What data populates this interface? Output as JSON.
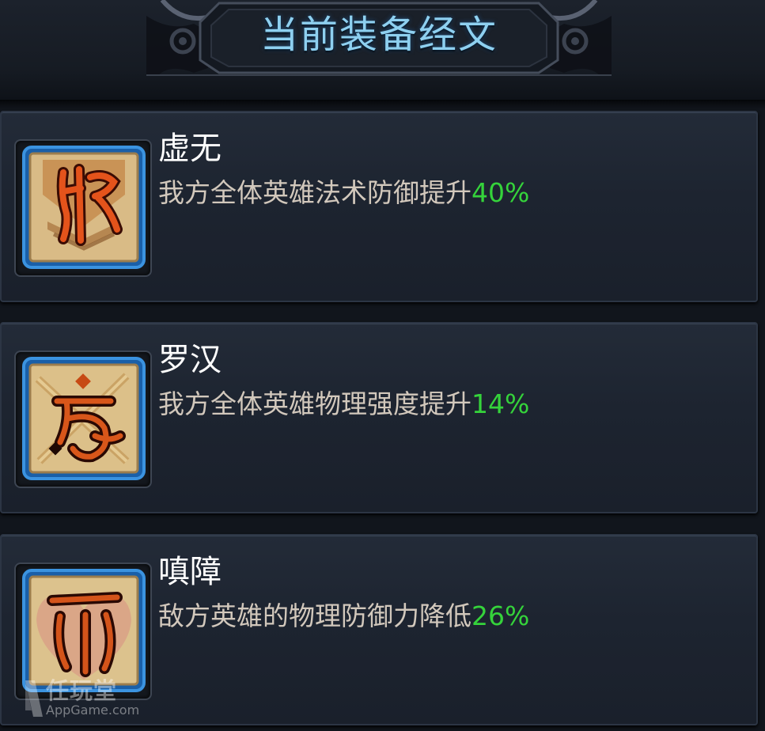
{
  "header": {
    "title": "当前装备经文"
  },
  "scriptures": [
    {
      "name": "虚无",
      "description": "我方全体英雄法术防御提升",
      "value": "40%",
      "icon": "scripture-rune-xuwu-icon"
    },
    {
      "name": "罗汉",
      "description": "我方全体英雄物理强度提升",
      "value": "14%",
      "icon": "scripture-rune-luohan-icon"
    },
    {
      "name": "嗔障",
      "description": "敌方英雄的物理防御力降低",
      "value": "26%",
      "icon": "scripture-rune-chenzhang-icon"
    }
  ],
  "watermark": {
    "brand": "任玩堂",
    "url": "AppGame.com"
  },
  "colors": {
    "title": "#8ed0f0",
    "value": "#35d33b",
    "description": "#d2c8bc",
    "icon_border": "#2a7fd0"
  }
}
